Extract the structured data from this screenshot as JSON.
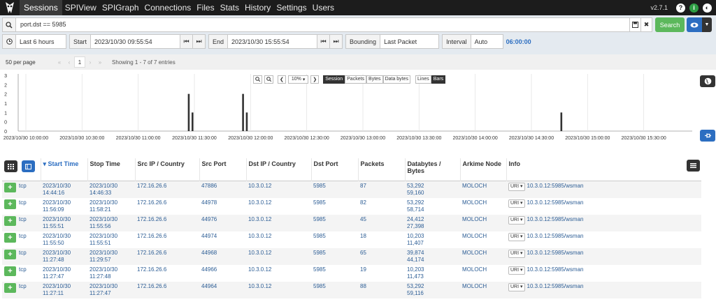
{
  "nav": {
    "items": [
      "Sessions",
      "SPIView",
      "SPIGraph",
      "Connections",
      "Files",
      "Stats",
      "History",
      "Settings",
      "Users"
    ],
    "active": "Sessions",
    "version": "v2.7.1",
    "help_icon": "question-icon",
    "status_icon": "health-icon"
  },
  "search": {
    "query": "port.dst == 5985",
    "search_label": "Search",
    "time_range": "Last 6 hours",
    "start_label": "Start",
    "start_value": "2023/10/30 09:55:54",
    "end_label": "End",
    "end_value": "2023/10/30 15:55:54",
    "bounding_label": "Bounding",
    "bounding_value": "Last Packet",
    "interval_label": "Interval",
    "interval_value": "Auto",
    "duration": "06:00:00"
  },
  "pager": {
    "per_page": "50 per page",
    "current_page": "1",
    "showing": "Showing 1 - 7 of 7 entries"
  },
  "chart_data": {
    "type": "bar",
    "y_ticks": [
      "3",
      "2",
      "2",
      "1",
      "1",
      "0",
      "0"
    ],
    "ylim": [
      0,
      3
    ],
    "x_ticks": [
      "2023/10/30 10:00:00",
      "2023/10/30 10:30:00",
      "2023/10/30 11:00:00",
      "2023/10/30 11:30:00",
      "2023/10/30 12:00:00",
      "2023/10/30 12:30:00",
      "2023/10/30 13:00:00",
      "2023/10/30 13:30:00",
      "2023/10/30 14:00:00",
      "2023/10/30 14:30:00",
      "2023/10/30 15:00:00",
      "2023/10/30 15:30:00"
    ],
    "bars": [
      {
        "time": "2023/10/30 11:27:00",
        "value": 2
      },
      {
        "time": "2023/10/30 11:29:00",
        "value": 1
      },
      {
        "time": "2023/10/30 11:56:00",
        "value": 2
      },
      {
        "time": "2023/10/30 11:58:00",
        "value": 1
      },
      {
        "time": "2023/10/30 14:46:00",
        "value": 1
      }
    ],
    "zoom": "10%",
    "controls": {
      "session": "Session",
      "packets": "Packets",
      "bytes": "Bytes",
      "databytes": "Data bytes",
      "lines": "Lines",
      "bars": "Bars"
    }
  },
  "table": {
    "headers": [
      "Start Time",
      "Stop Time",
      "Src IP / Country",
      "Src Port",
      "Dst IP / Country",
      "Dst Port",
      "Packets",
      "Databytes / Bytes",
      "Arkime Node",
      "Info"
    ],
    "rows": [
      {
        "proto": "tcp",
        "start": "2023/10/30 14:44:16",
        "stop": "2023/10/30 14:46:33",
        "src_ip": "172.16.26.6",
        "src_port": "47886",
        "dst_ip": "10.3.0.12",
        "dst_port": "5985",
        "packets": "87",
        "databytes": "53,292",
        "bytes": "59,160",
        "node": "MOLOCH",
        "uri_label": "URI",
        "info": "10.3.0.12:5985/wsman"
      },
      {
        "proto": "tcp",
        "start": "2023/10/30 11:56:09",
        "stop": "2023/10/30 11:58:21",
        "src_ip": "172.16.26.6",
        "src_port": "44978",
        "dst_ip": "10.3.0.12",
        "dst_port": "5985",
        "packets": "82",
        "databytes": "53,292",
        "bytes": "58,714",
        "node": "MOLOCH",
        "uri_label": "URI",
        "info": "10.3.0.12:5985/wsman"
      },
      {
        "proto": "tcp",
        "start": "2023/10/30 11:55:51",
        "stop": "2023/10/30 11:55:56",
        "src_ip": "172.16.26.6",
        "src_port": "44976",
        "dst_ip": "10.3.0.12",
        "dst_port": "5985",
        "packets": "45",
        "databytes": "24,412",
        "bytes": "27,398",
        "node": "MOLOCH",
        "uri_label": "URI",
        "info": "10.3.0.12:5985/wsman"
      },
      {
        "proto": "tcp",
        "start": "2023/10/30 11:55:50",
        "stop": "2023/10/30 11:55:51",
        "src_ip": "172.16.26.6",
        "src_port": "44974",
        "dst_ip": "10.3.0.12",
        "dst_port": "5985",
        "packets": "18",
        "databytes": "10,203",
        "bytes": "11,407",
        "node": "MOLOCH",
        "uri_label": "URI",
        "info": "10.3.0.12:5985/wsman"
      },
      {
        "proto": "tcp",
        "start": "2023/10/30 11:27:48",
        "stop": "2023/10/30 11:29:57",
        "src_ip": "172.16.26.6",
        "src_port": "44968",
        "dst_ip": "10.3.0.12",
        "dst_port": "5985",
        "packets": "65",
        "databytes": "39,874",
        "bytes": "44,174",
        "node": "MOLOCH",
        "uri_label": "URI",
        "info": "10.3.0.12:5985/wsman"
      },
      {
        "proto": "tcp",
        "start": "2023/10/30 11:27:47",
        "stop": "2023/10/30 11:27:48",
        "src_ip": "172.16.26.6",
        "src_port": "44966",
        "dst_ip": "10.3.0.12",
        "dst_port": "5985",
        "packets": "19",
        "databytes": "10,203",
        "bytes": "11,473",
        "node": "MOLOCH",
        "uri_label": "URI",
        "info": "10.3.0.12:5985/wsman"
      },
      {
        "proto": "tcp",
        "start": "2023/10/30 11:27:11",
        "stop": "2023/10/30 11:27:47",
        "src_ip": "172.16.26.6",
        "src_port": "44964",
        "dst_ip": "10.3.0.12",
        "dst_port": "5985",
        "packets": "88",
        "databytes": "53,292",
        "bytes": "59,116",
        "node": "MOLOCH",
        "uri_label": "URI",
        "info": "10.3.0.12:5985/wsman"
      }
    ]
  },
  "colors": {
    "accent": "#2c6ec1",
    "success": "#5cb85c",
    "nav_bg": "#1c1c1c"
  }
}
